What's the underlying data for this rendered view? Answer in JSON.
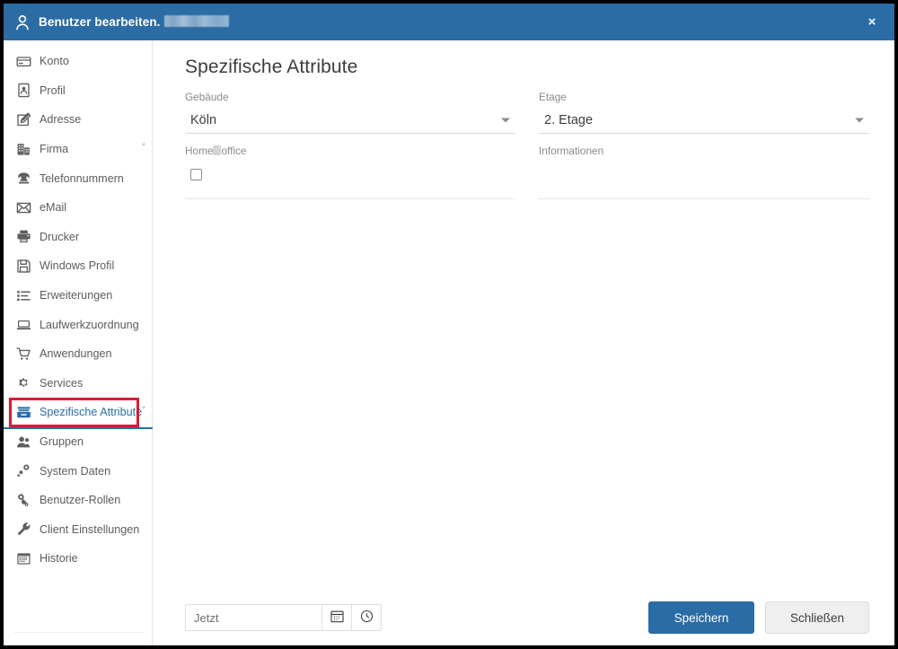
{
  "window": {
    "title_prefix": "Benutzer bearbeiten.",
    "title_redacted": true,
    "close_label": "×",
    "user_icon": "user-icon",
    "accent_color": "#2a6ca5",
    "highlight_color": "#d81b34"
  },
  "sidebar": {
    "items": [
      {
        "label": "Konto",
        "icon": "card-icon",
        "active": false,
        "required_marker": ""
      },
      {
        "label": "Profil",
        "icon": "id-badge-icon",
        "active": false,
        "required_marker": ""
      },
      {
        "label": "Adresse",
        "icon": "edit-square-icon",
        "active": false,
        "required_marker": ""
      },
      {
        "label": "Firma",
        "icon": "building-icon",
        "active": false,
        "required_marker": "*"
      },
      {
        "label": "Telefonnummern",
        "icon": "phone-icon",
        "active": false,
        "required_marker": ""
      },
      {
        "label": "eMail",
        "icon": "envelope-icon",
        "active": false,
        "required_marker": ""
      },
      {
        "label": "Drucker",
        "icon": "printer-icon",
        "active": false,
        "required_marker": ""
      },
      {
        "label": "Windows Profil",
        "icon": "floppy-disk-icon",
        "active": false,
        "required_marker": ""
      },
      {
        "label": "Erweiterungen",
        "icon": "list-icon",
        "active": false,
        "required_marker": ""
      },
      {
        "label": "Laufwerkzuordnung",
        "icon": "monitor-icon",
        "active": false,
        "required_marker": ""
      },
      {
        "label": "Anwendungen",
        "icon": "cart-icon",
        "active": false,
        "required_marker": ""
      },
      {
        "label": "Services",
        "icon": "gear-icon",
        "active": false,
        "required_marker": ""
      },
      {
        "label": "Spezifische Attribute",
        "icon": "drawer-icon",
        "active": true,
        "required_marker": "*"
      },
      {
        "label": "Gruppen",
        "icon": "users-icon",
        "active": false,
        "required_marker": ""
      },
      {
        "label": "System Daten",
        "icon": "nodes-icon",
        "active": false,
        "required_marker": ""
      },
      {
        "label": "Benutzer-Rollen",
        "icon": "key-user-icon",
        "active": false,
        "required_marker": ""
      },
      {
        "label": "Client Einstellungen",
        "icon": "wrench-icon",
        "active": false,
        "required_marker": ""
      },
      {
        "label": "Historie",
        "icon": "calendar-icon",
        "active": false,
        "required_marker": ""
      }
    ]
  },
  "main": {
    "page_title": "Spezifische Attribute",
    "fields": {
      "gebaeude": {
        "label": "Gebäude",
        "value": "Köln",
        "type": "select"
      },
      "etage": {
        "label": "Etage",
        "value": "2. Etage",
        "type": "select"
      },
      "homeoffice": {
        "label_before": "Home",
        "label_after": "office",
        "has_redaction": true,
        "checked": false,
        "type": "checkbox"
      },
      "informationen": {
        "label": "Informationen",
        "value": "",
        "type": "textarea"
      }
    }
  },
  "footer": {
    "datetime_value": "",
    "datetime_placeholder": "Jetzt",
    "calendar_icon": "calendar-icon",
    "clock_icon": "clock-icon",
    "save_label": "Speichern",
    "close_label": "Schließen"
  }
}
